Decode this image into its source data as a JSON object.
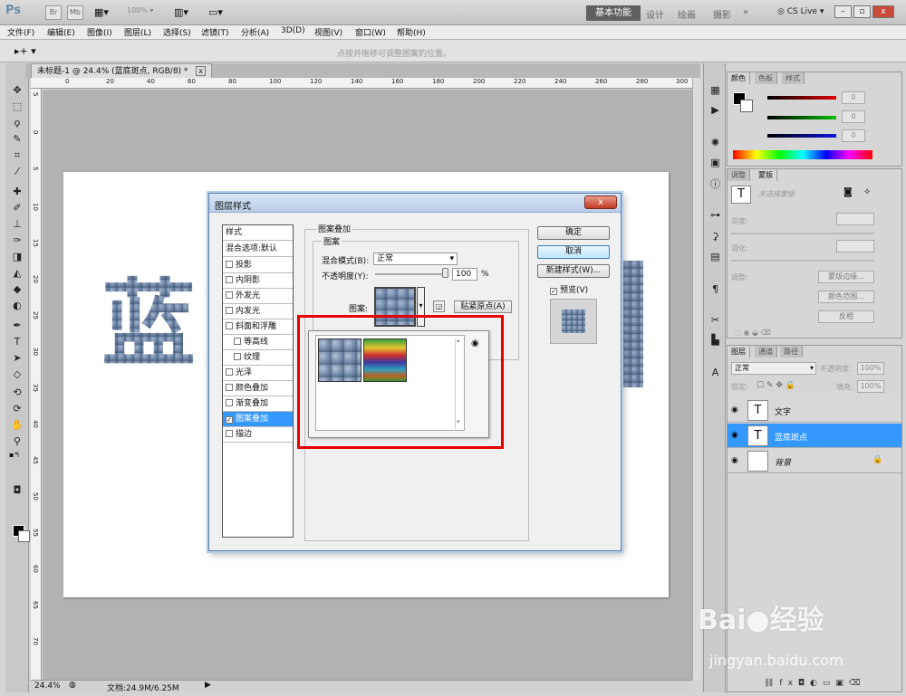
{
  "app": {
    "logo": "Ps",
    "zoom": "100%",
    "workspace_active": "基本功能",
    "workspaces": [
      "设计",
      "绘画",
      "摄影"
    ],
    "cslive": "CS Live"
  },
  "menu": [
    "文件(F)",
    "编辑(E)",
    "图像(I)",
    "图层(L)",
    "选择(S)",
    "滤镜(T)",
    "分析(A)",
    "3D(D)",
    "视图(V)",
    "窗口(W)",
    "帮助(H)"
  ],
  "options_hint": "点按并拖移可调整图案的位置。",
  "document": {
    "tab_title": "未标题-1 @ 24.4% (蓝底斑点, RGB/8) *",
    "canvas_text": "蓝",
    "canvas_text_right": "　",
    "status_zoom": "24.4%",
    "status_doc": "文档:24.9M/6.25M"
  },
  "ruler": {
    "h": [
      "0",
      "20",
      "40",
      "60",
      "80",
      "100",
      "120",
      "140",
      "160",
      "180",
      "200",
      "220",
      "240",
      "260",
      "280",
      "300"
    ],
    "v": [
      "5",
      "0",
      "5",
      "10",
      "15",
      "20",
      "25",
      "30",
      "35",
      "40",
      "45",
      "50",
      "55",
      "60",
      "65",
      "70"
    ]
  },
  "color_panel": {
    "tabs": [
      "颜色",
      "色板",
      "样式"
    ],
    "values": [
      "0",
      "0",
      "0"
    ],
    "colors": {
      "r": "#d40000",
      "g": "#00b000",
      "b": "#1010d0"
    }
  },
  "adjust_panel": {
    "tabs": [
      "调整",
      "蒙版"
    ],
    "no_selection": "未选择蒙版",
    "density": "浓度:",
    "feather": "羽化:",
    "refine": "调整:",
    "buttons": [
      "蒙版边缘...",
      "颜色范围...",
      "反相"
    ]
  },
  "layers_panel": {
    "tabs": [
      "图层",
      "通道",
      "路径"
    ],
    "blend": "正常",
    "opacity_label": "不透明度:",
    "opacity": "100%",
    "lock_label": "锁定:",
    "fill_label": "填充:",
    "fill": "100%",
    "layers": [
      {
        "name": "文字",
        "thumb": "T",
        "selected": false
      },
      {
        "name": "蓝底斑点",
        "thumb": "T",
        "selected": true
      },
      {
        "name": "背景",
        "thumb": "",
        "selected": false
      }
    ]
  },
  "dialog": {
    "title": "图层样式",
    "close": "x",
    "styles_header": "样式",
    "blend_options": "混合选项:默认",
    "effects": [
      {
        "label": "投影",
        "checked": false,
        "indent": false
      },
      {
        "label": "内阴影",
        "checked": false,
        "indent": false
      },
      {
        "label": "外发光",
        "checked": false,
        "indent": false
      },
      {
        "label": "内发光",
        "checked": false,
        "indent": false
      },
      {
        "label": "斜面和浮雕",
        "checked": false,
        "indent": false
      },
      {
        "label": "等高线",
        "checked": false,
        "indent": true
      },
      {
        "label": "纹理",
        "checked": false,
        "indent": true
      },
      {
        "label": "光泽",
        "checked": false,
        "indent": false
      },
      {
        "label": "颜色叠加",
        "checked": false,
        "indent": false
      },
      {
        "label": "渐变叠加",
        "checked": false,
        "indent": false
      },
      {
        "label": "图案叠加",
        "checked": true,
        "indent": false
      },
      {
        "label": "描边",
        "checked": false,
        "indent": false
      }
    ],
    "section_title": "图案叠加",
    "group_title": "图案",
    "blend_label": "混合模式(B):",
    "blend_value": "正常",
    "opacity_label": "不透明度(Y):",
    "opacity_value": "100",
    "opacity_unit": "%",
    "opacity_level": 1.0,
    "pattern_label": "图案:",
    "snap_button": "贴紧原点(A)",
    "ok": "确定",
    "cancel": "取消",
    "new_style": "新建样式(W)...",
    "preview_label": "预览(V)",
    "preview_checked": true
  },
  "watermark": {
    "main": "Bai●经验",
    "sub": "jingyan.baidu.com"
  }
}
